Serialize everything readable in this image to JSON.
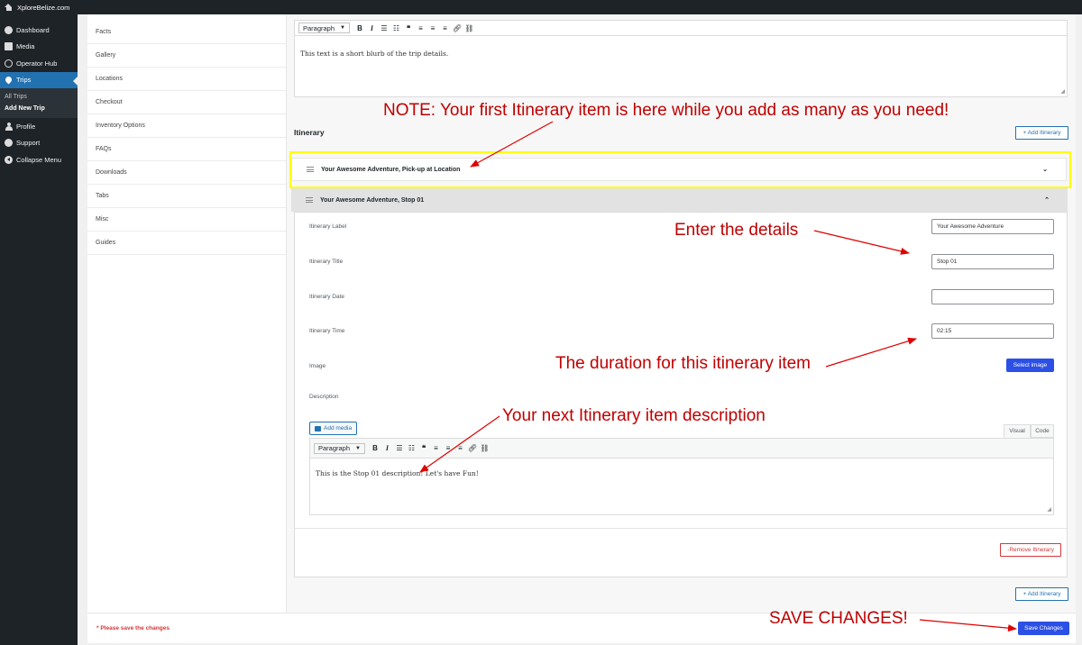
{
  "adminbar": {
    "site_name": "XploreBelize.com",
    "home_icon": "home-icon"
  },
  "admin_menu": {
    "items": [
      {
        "label": "Dashboard",
        "icon": "dashboard-icon"
      },
      {
        "label": "Media",
        "icon": "media-icon"
      },
      {
        "label": "Operator Hub",
        "icon": "operator-hub-icon"
      },
      {
        "label": "Trips",
        "icon": "location-pin-icon",
        "active": true
      },
      {
        "label": "Profile",
        "icon": "profile-icon"
      },
      {
        "label": "Support",
        "icon": "support-icon"
      },
      {
        "label": "Collapse Menu",
        "icon": "collapse-icon"
      }
    ],
    "submenu": [
      "All Trips",
      "Add New Trip"
    ]
  },
  "side_tabs": [
    "Facts",
    "Gallery",
    "Locations",
    "Checkout",
    "Inventory Options",
    "FAQs",
    "Downloads",
    "Tabs",
    "Misc",
    "Guides"
  ],
  "top_editor": {
    "format": "Paragraph",
    "text": "This text is a short blurb of the trip details."
  },
  "itinerary": {
    "title": "Itinerary",
    "add_button": "+ Add Itinerary",
    "items": [
      {
        "title": "Your Awesome Adventure, Pick-up at Location",
        "expanded": false
      },
      {
        "title": "Your Awesome Adventure, Stop 01",
        "expanded": true
      }
    ],
    "fields": {
      "label_label": "Itinerary Label",
      "label_value": "Your Awesome Adventure",
      "title_label": "Itinerary Title",
      "title_value": "Stop 01",
      "date_label": "Itinerary Date",
      "date_value": "",
      "time_label": "Itinerary Time",
      "time_value": "02:15",
      "image_label": "Image",
      "select_image": "Select image",
      "description_label": "Description"
    },
    "desc_editor": {
      "add_media": "Add media",
      "tab_visual": "Visual",
      "tab_code": "Code",
      "format": "Paragraph",
      "text": "This is the Stop 01 description! Let's have Fun!"
    },
    "remove_button": "-Remove Itinerary",
    "add_button_bottom": "+ Add Itinerary"
  },
  "footer": {
    "warning": "* Please save the changes",
    "save_button": "Save Changes"
  },
  "annotations": {
    "note_first": "NOTE: Your first Itinerary item is here while you add as many as you need!",
    "enter_details": "Enter the details",
    "duration": "The duration for this itinerary item",
    "next_desc": "Your next Itinerary item description",
    "save": "SAVE CHANGES!",
    "color": "#c00000",
    "highlight_color": "#ffff00"
  }
}
